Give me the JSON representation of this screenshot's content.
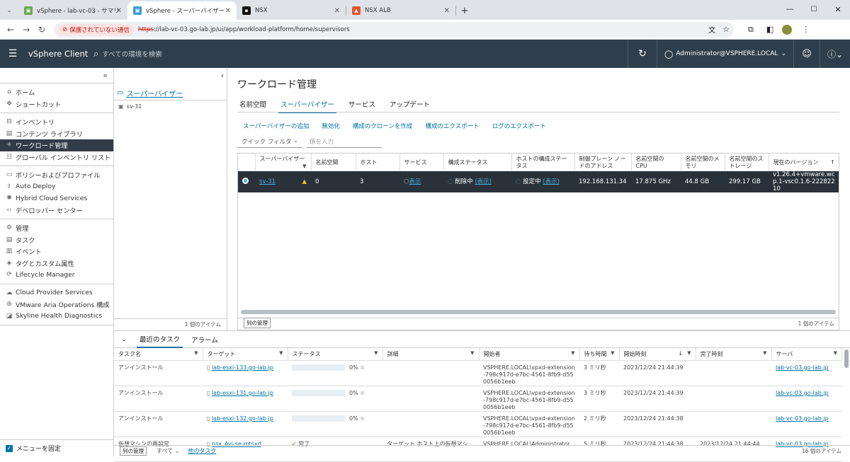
{
  "browser": {
    "tabs": [
      {
        "label": "vSphere - lab-vc-03 - サマリ",
        "favicon": "vsphere-summary",
        "color": "#6aa84f"
      },
      {
        "label": "vSphere - スーパーバイザー",
        "favicon": "vsphere",
        "color": "#3d9bd1"
      },
      {
        "label": "NSX",
        "favicon": "nsx",
        "color": "#111111"
      },
      {
        "label": "NSX ALB",
        "favicon": "avi",
        "color": "#e8542c"
      }
    ],
    "insecure_label": "保護されていない通信",
    "url_scheme": "https",
    "url_rest": "://lab-vc-03.go-lab.jp/ui/app/workload-platform/home/supervisors"
  },
  "header": {
    "app_name": "vSphere Client",
    "search_placeholder": "すべての環境を検索",
    "user": "Administrator@VSPHERE.LOCAL"
  },
  "sidebar": {
    "groups": [
      [
        {
          "label": "ホーム",
          "icon": "home-icon"
        },
        {
          "label": "ショートカット",
          "icon": "shortcut-icon"
        }
      ],
      [
        {
          "label": "インベントリ",
          "icon": "inventory-icon"
        },
        {
          "label": "コンテンツ ライブラリ",
          "icon": "library-icon"
        },
        {
          "label": "ワークロード管理",
          "icon": "workload-icon",
          "selected": true
        },
        {
          "label": "グローバル インベントリ リスト",
          "icon": "list-icon"
        }
      ],
      [
        {
          "label": "ポリシーおよびプロファイル",
          "icon": "policy-icon"
        },
        {
          "label": "Auto Deploy",
          "icon": "autodeploy-icon"
        },
        {
          "label": "Hybrid Cloud Services",
          "icon": "cloud-icon"
        },
        {
          "label": "デベロッパー センター",
          "icon": "code-icon"
        }
      ],
      [
        {
          "label": "管理",
          "icon": "admin-icon"
        },
        {
          "label": "タスク",
          "icon": "tasks-icon"
        },
        {
          "label": "イベント",
          "icon": "events-icon"
        },
        {
          "label": "タグとカスタム属性",
          "icon": "tag-icon"
        },
        {
          "label": "Lifecycle Manager",
          "icon": "lifecycle-icon"
        }
      ],
      [
        {
          "label": "Cloud Provider Services",
          "icon": "cloud-provider-icon"
        },
        {
          "label": "VMware Aria Operations 構成",
          "icon": "aria-icon"
        },
        {
          "label": "Skyline Health Diagnostics",
          "icon": "skyline-icon"
        }
      ]
    ],
    "pin_label": "メニューを固定"
  },
  "tree": {
    "title": "スーパーバイザー",
    "item": "sv-31",
    "count": "1 個のアイテム"
  },
  "main": {
    "title": "ワークロード管理",
    "tabs": [
      "名前空間",
      "スーパーバイザー",
      "サービス",
      "アップデート"
    ],
    "actions": [
      "スーパーバイザーの追加",
      "無効化",
      "構成のクローンを作成",
      "構成のエクスポート",
      "ログのエクスポート"
    ],
    "quick_filter": "クイック フィルタ",
    "filter_placeholder": "値を入力",
    "columns": [
      "スーパーバイザー",
      "名前空間",
      "ホスト",
      "サービス",
      "構成ステータス",
      "ホストの構成ステータス",
      "制御プレーン ノードのアドレス",
      "名前空間の CPU",
      "名前空間のメモリ",
      "名前空間のストレージ",
      "現在のバージョン"
    ],
    "row": {
      "supervisor": "sv-31",
      "namespaces": "0",
      "hosts": "3",
      "services": "表示",
      "config_status": "削除中",
      "config_status_link": "(表示)",
      "host_config_status": "設定中",
      "host_config_link": "(表示)",
      "address": "192.168.131.34",
      "cpu": "17.875 GHz",
      "memory": "44.8 GB",
      "storage": "299.17 GB",
      "version": "v1.26.4+vmware.wcp.1-vsc0.1.6-22282210"
    },
    "manage_columns": "列の管理",
    "count": "1 個のアイテム"
  },
  "tasks": {
    "tabs": [
      "最近のタスク",
      "アラーム"
    ],
    "columns": [
      "タスク名",
      "ターゲット",
      "ステータス",
      "詳細",
      "開始者",
      "待ち時間",
      "開始時刻",
      "完了時刻",
      "サーバ"
    ],
    "rows": [
      {
        "name": "アンインストール",
        "target": "lab-esxi-133.go-lab.jp",
        "status": "0%",
        "details": "",
        "initiator": "VSPHERE.LOCAL\\vpxd-extension-798c917d-e7bc-4561-8fb9-d550056b1eeb",
        "wait": "3 ミリ秒",
        "start": "2023/12/24 21:44:39",
        "end": "",
        "server": "lab-vc-03.go-lab.jp"
      },
      {
        "name": "アンインストール",
        "target": "lab-esxi-131.go-lab.jp",
        "status": "0%",
        "details": "",
        "initiator": "VSPHERE.LOCAL\\vpxd-extension-798c917d-e7bc-4561-8fb9-d550056b1eeb",
        "wait": "3 ミリ秒",
        "start": "2023/12/24 21:44:39",
        "end": "",
        "server": "lab-vc-03.go-lab.jp"
      },
      {
        "name": "アンインストール",
        "target": "lab-esxi-132.go-lab.jp",
        "status": "0%",
        "details": "",
        "initiator": "VSPHERE.LOCAL\\vpxd-extension-798c917d-e7bc-4561-8fb9-d550056b1eeb",
        "wait": "2 ミリ秒",
        "start": "2023/12/24 21:44:38",
        "end": "",
        "server": "lab-vc-03.go-lab.jp"
      },
      {
        "name": "仮想マシンの再設定",
        "target": "nsx_Avi-se-mtsxd",
        "status": "完了",
        "details": "ターゲット ホスト上の仮想マシ",
        "initiator": "VSPHERE.LOCAL\\Administrator",
        "wait": "5 ミリ秒",
        "start": "2023/12/24 21:44:38",
        "end": "2023/12/24 21:44:44",
        "server": "lab-vc-03.go-lab.jp"
      }
    ],
    "footer_manage": "列の管理",
    "footer_filter": "すべて",
    "footer_more": "他のタスク",
    "count": "16 個のアイテム"
  }
}
